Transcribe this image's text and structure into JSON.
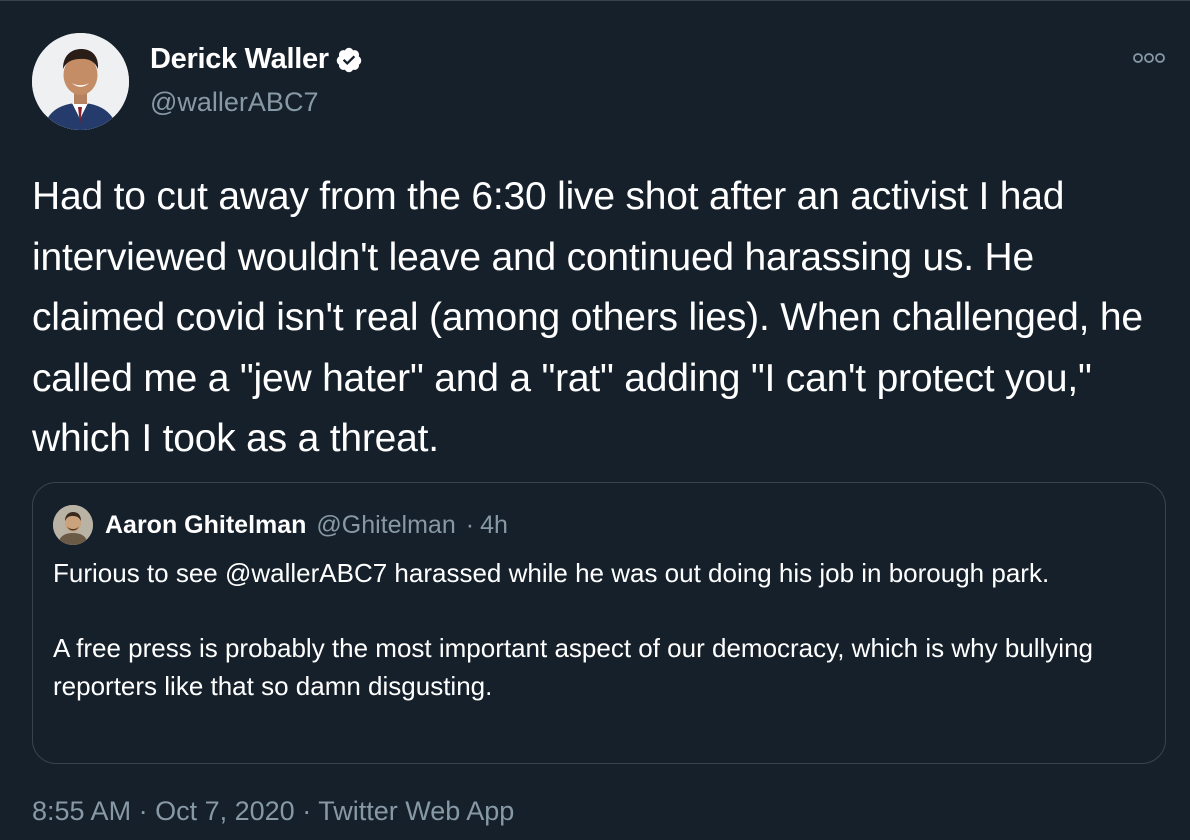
{
  "author": {
    "display_name": "Derick Waller",
    "handle": "@wallerABC7",
    "verified": true,
    "avatar_icon": "profile-photo"
  },
  "tweet": {
    "text": "Had to cut away from the 6:30 live shot after an activist I had interviewed wouldn't leave and continued harassing us. He claimed covid isn't real (among others lies). When challenged, he called me a \"jew hater\" and a \"rat\" adding \"I can't protect you,\" which I took as a threat."
  },
  "quoted_tweet": {
    "display_name": "Aaron Ghitelman",
    "handle": "@Ghitelman",
    "separator": "·",
    "age": "4h",
    "paragraphs": [
      "Furious to see @wallerABC7 harassed while he was out doing his job in borough park.",
      "A free press is probably the most important aspect of our democracy, which is why bullying reporters like that so damn disgusting."
    ]
  },
  "footer": {
    "time": "8:55 AM",
    "date": "Oct 7, 2020",
    "source": "Twitter Web App",
    "separator": "·"
  },
  "colors": {
    "background": "#15202b",
    "text_primary": "#ffffff",
    "text_secondary": "#8899a6",
    "border": "#38444d"
  }
}
